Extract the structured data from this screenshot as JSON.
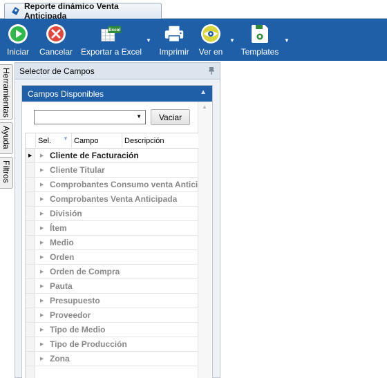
{
  "document_tab": {
    "title": "Reporte dinámico Venta Anticipada",
    "icon": "report-icon"
  },
  "toolbar": {
    "iniciar": "Iniciar",
    "cancelar": "Cancelar",
    "exportar": "Exportar a Excel",
    "excel_badge": "Excel",
    "imprimir": "Imprimir",
    "ver_en": "Ver en",
    "templates": "Templates",
    "colors": {
      "ribbon": "#1f5fa8",
      "start": "#2eb84a",
      "cancel": "#e2463a"
    }
  },
  "side_tabs": [
    "Herramientas",
    "Ayuda",
    "Filtros"
  ],
  "panel": {
    "title": "Selector de Campos",
    "group_title": "Campos Disponibles",
    "combo_value": "",
    "clear_button": "Vaciar",
    "columns": [
      "Sel.",
      "Campo",
      "Descripción"
    ],
    "rows": [
      "Cliente de Facturación",
      "Cliente Titular",
      "Comprobantes Consumo venta Anticipada",
      "Comprobantes Venta Anticipada",
      "División",
      "Ítem",
      "Medio",
      "Orden",
      "Orden de Compra",
      "Pauta",
      "Presupuesto",
      "Proveedor",
      "Tipo de Medio",
      "Tipo de Producción",
      "Zona"
    ]
  }
}
